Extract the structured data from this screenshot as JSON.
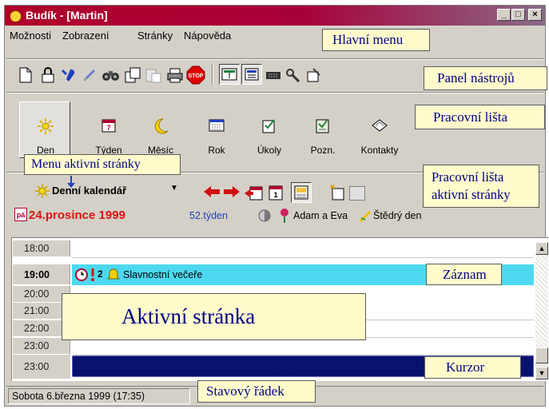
{
  "window": {
    "title": "Budík - [Martin]",
    "controls": {
      "minimize": "_",
      "maximize": "□",
      "close": "×"
    }
  },
  "menu": {
    "items": [
      "Možnosti",
      "Zobrazení",
      "Stránky",
      "Nápověda"
    ]
  },
  "toolbar": {
    "icons": [
      "new-icon",
      "lock-icon",
      "tools-icon",
      "link-icon",
      "binoculars-icon",
      "copy-icon",
      "paste-icon",
      "print-icon",
      "stop-icon",
      "view1-icon",
      "view2-icon",
      "view3-icon",
      "tools2-icon",
      "settings-icon"
    ],
    "stop_label": "STOP"
  },
  "workbar": {
    "items": [
      {
        "label": "Den",
        "icon": "sun-icon"
      },
      {
        "label": "Týden",
        "icon": "week-icon"
      },
      {
        "label": "Měsíc",
        "icon": "moon-icon"
      },
      {
        "label": "Rok",
        "icon": "year-icon"
      },
      {
        "label": "Úkoly",
        "icon": "tasks-icon"
      },
      {
        "label": "Pozn.",
        "icon": "notes-icon"
      },
      {
        "label": "Kontakty",
        "icon": "contacts-icon"
      }
    ]
  },
  "page": {
    "view_label": "Denní kalendář",
    "date_icon_text": "pá",
    "date": "24.prosince 1999",
    "week": "52.týden",
    "nameday": "Adam a Eva",
    "holiday": "Štědrý den"
  },
  "calendar": {
    "hours": [
      "18:00",
      "19:00",
      "20:00",
      "21:00",
      "22:00",
      "23:00"
    ],
    "active_hour": "19:00",
    "entry": {
      "priority": "2",
      "text": "Slavnostní večeře"
    }
  },
  "statusbar": {
    "text": "Sobota 6.března 1999 (17:35)"
  },
  "callouts": {
    "main_menu": "Hlavní menu",
    "toolbar": "Panel nástrojů",
    "workbar": "Pracovní lišta",
    "page_menu": "Menu aktivní stránky",
    "page_workbar_line1": "Pracovní lišta",
    "page_workbar_line2": "aktivní stránky",
    "record": "Záznam",
    "active_page": "Aktivní stránka",
    "cursor": "Kurzor",
    "status_line": "Stavový řádek"
  },
  "colors": {
    "title_bar": "#b0002a",
    "record_row": "#4cd9f0",
    "cursor_row": "#0a1270",
    "callout_bg": "#fffbcb",
    "callout_text": "#00008b",
    "date_red": "#e01010",
    "week_blue": "#1f3fbf"
  }
}
